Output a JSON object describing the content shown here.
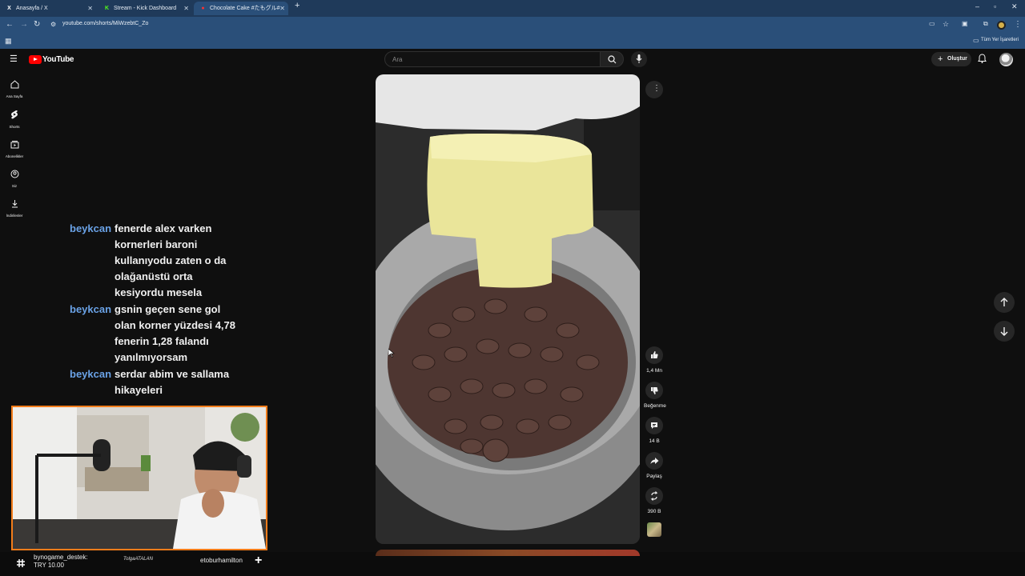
{
  "browser": {
    "tabs": [
      {
        "label": "Anasayfa / X",
        "favicon": "x-icon",
        "active": false
      },
      {
        "label": "Stream - Kick Dashboard",
        "favicon": "kick-icon",
        "active": false
      },
      {
        "label": "Chocolate Cake #たもグル#",
        "favicon": "youtube-icon",
        "active": true
      }
    ],
    "url": "youtube.com/shorts/MiWzebtC_Zo",
    "bookmarks_label": "Tüm Yer İşaretleri"
  },
  "youtube": {
    "logo_text": "YouTube",
    "search_placeholder": "Ara",
    "create_label": "Oluştur",
    "nav": [
      {
        "label": "Ana Sayfa",
        "icon": "home-icon"
      },
      {
        "label": "Shorts",
        "icon": "shorts-icon"
      },
      {
        "label": "Abonelikler",
        "icon": "subscriptions-icon"
      },
      {
        "label": "Siz",
        "icon": "you-icon"
      },
      {
        "label": "İndirilenler",
        "icon": "download-icon"
      }
    ],
    "actions": {
      "like": "1,4 Mn",
      "dislike": "Beğenme",
      "comments": "14 B",
      "share": "Paylaş",
      "remix": "390 B"
    }
  },
  "chat": [
    {
      "user": "beykcan",
      "text": "fenerde alex varken kornerleri baroni kullanıyodu zaten o da olağanüstü orta kesiyordu mesela"
    },
    {
      "user": "beykcan",
      "text": "gsnin geçen sene gol olan korner yüzdesi 4,78 fenerin 1,28 falandı yanılmıyorsam"
    },
    {
      "user": "beykcan",
      "text": "serdar abim ve sallama hikayeleri"
    }
  ],
  "ticker": {
    "donation_user": "bynogame_destek:",
    "donation_amount": "TRY 10.00",
    "signature": "TolgaATALAN",
    "follower": "etoburhamilton"
  },
  "colors": {
    "chat_user": "#6aa2e6",
    "webcam_border": "#f27c1a",
    "browser_chrome": "#2a4f79"
  }
}
